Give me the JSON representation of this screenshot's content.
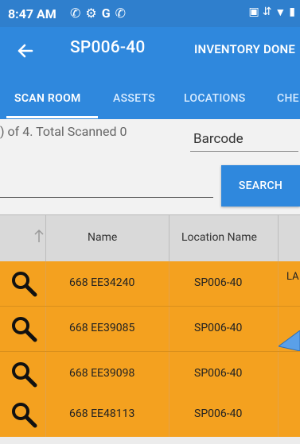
{
  "status_bar": {
    "time": "8:47 AM",
    "left_icons": [
      "phone-icon",
      "gear-icon",
      "google-icon",
      "phone-icon"
    ],
    "right_icons": [
      "sim-icon",
      "data-icon",
      "wifi-icon",
      "battery-icon"
    ]
  },
  "app_bar": {
    "title": "SP006-40",
    "action_label": "INVENTORY DONE"
  },
  "tabs": [
    {
      "label": "SCAN ROOM",
      "active": true
    },
    {
      "label": "ASSETS",
      "active": false
    },
    {
      "label": "LOCATIONS",
      "active": false
    },
    {
      "label": "CHE",
      "active": false
    }
  ],
  "scan": {
    "summary": ") of 4. Total Scanned 0",
    "field_label": "Barcode",
    "input_value": "",
    "search_label": "SEARCH"
  },
  "table": {
    "columns": [
      "Name",
      "Location Name"
    ],
    "rows": [
      {
        "name": "668 EE34240",
        "location": "SP006-40",
        "extra": "LA"
      },
      {
        "name": "668 EE39085",
        "location": "SP006-40",
        "extra": ""
      },
      {
        "name": "668 EE39098",
        "location": "SP006-40",
        "extra": ""
      },
      {
        "name": "668 EE48113",
        "location": "SP006-40",
        "extra": ""
      }
    ]
  },
  "colors": {
    "status_bar": "#2f7fcd",
    "app_bar": "#2f88dd",
    "row_highlight": "#f4a11f",
    "header_bg": "#d9d9d9"
  }
}
